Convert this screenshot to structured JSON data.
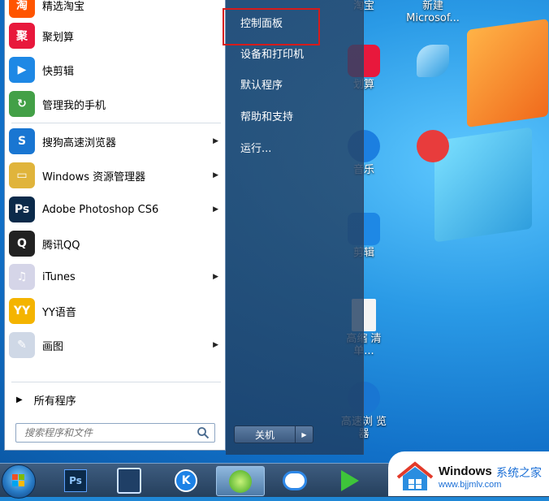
{
  "desktop": {
    "icons": [
      {
        "label": "淘宝"
      },
      {
        "label": "新建 Microsof..."
      },
      {
        "label": "划算"
      },
      {
        "label": "音乐"
      },
      {
        "label": "剪辑"
      },
      {
        "label": "高缩 清单..."
      },
      {
        "label": "高速浏 览器"
      }
    ]
  },
  "start_menu": {
    "programs": [
      {
        "label": "精选淘宝",
        "icon": "taobao-icon",
        "color": "#ff5500",
        "glyph": "淘"
      },
      {
        "label": "聚划算",
        "icon": "juhuasuan-icon",
        "color": "#e8183c",
        "glyph": "聚"
      },
      {
        "label": "快剪辑",
        "icon": "kuaijianji-icon",
        "color": "#1e88e5",
        "glyph": "▶"
      },
      {
        "label": "管理我的手机",
        "icon": "phone-manager-icon",
        "color": "#43a047",
        "glyph": "↻"
      },
      {
        "label": "搜狗高速浏览器",
        "icon": "sogou-browser-icon",
        "color": "#1976d2",
        "glyph": "S",
        "submenu": true
      },
      {
        "label": "Windows 资源管理器",
        "icon": "folder-icon",
        "color": "#e0b43b",
        "glyph": "▭",
        "submenu": true
      },
      {
        "label": "Adobe Photoshop CS6",
        "icon": "photoshop-icon",
        "color": "#0b2a4a",
        "glyph": "Ps",
        "submenu": true
      },
      {
        "label": "腾讯QQ",
        "icon": "qq-icon",
        "color": "#222222",
        "glyph": "Q"
      },
      {
        "label": "iTunes",
        "icon": "itunes-icon",
        "color": "#d5d5e8",
        "glyph": "♫",
        "submenu": true
      },
      {
        "label": "YY语音",
        "icon": "yy-icon",
        "color": "#f4b400",
        "glyph": "YY"
      },
      {
        "label": "画图",
        "icon": "paint-icon",
        "color": "#cfd8e6",
        "glyph": "✎",
        "submenu": true
      }
    ],
    "all_programs": "所有程序",
    "search_placeholder": "搜索程序和文件",
    "right_items": [
      "控制面板",
      "设备和打印机",
      "默认程序",
      "帮助和支持",
      "运行..."
    ],
    "shutdown_label": "关机",
    "highlight_color": "#d61b1b"
  },
  "taskbar": {
    "items": [
      {
        "icon": "photoshop-icon",
        "label": "Ps"
      },
      {
        "icon": "video-editor-icon",
        "label": ""
      },
      {
        "icon": "kugou-icon",
        "label": "K"
      },
      {
        "icon": "sogou-browser-icon",
        "label": ""
      },
      {
        "icon": "baidu-cloud-icon",
        "label": ""
      },
      {
        "icon": "media-player-icon",
        "label": ""
      }
    ]
  },
  "watermark": {
    "title": "Windows",
    "cn": "系统之家",
    "url": "www.bjjmlv.com"
  }
}
